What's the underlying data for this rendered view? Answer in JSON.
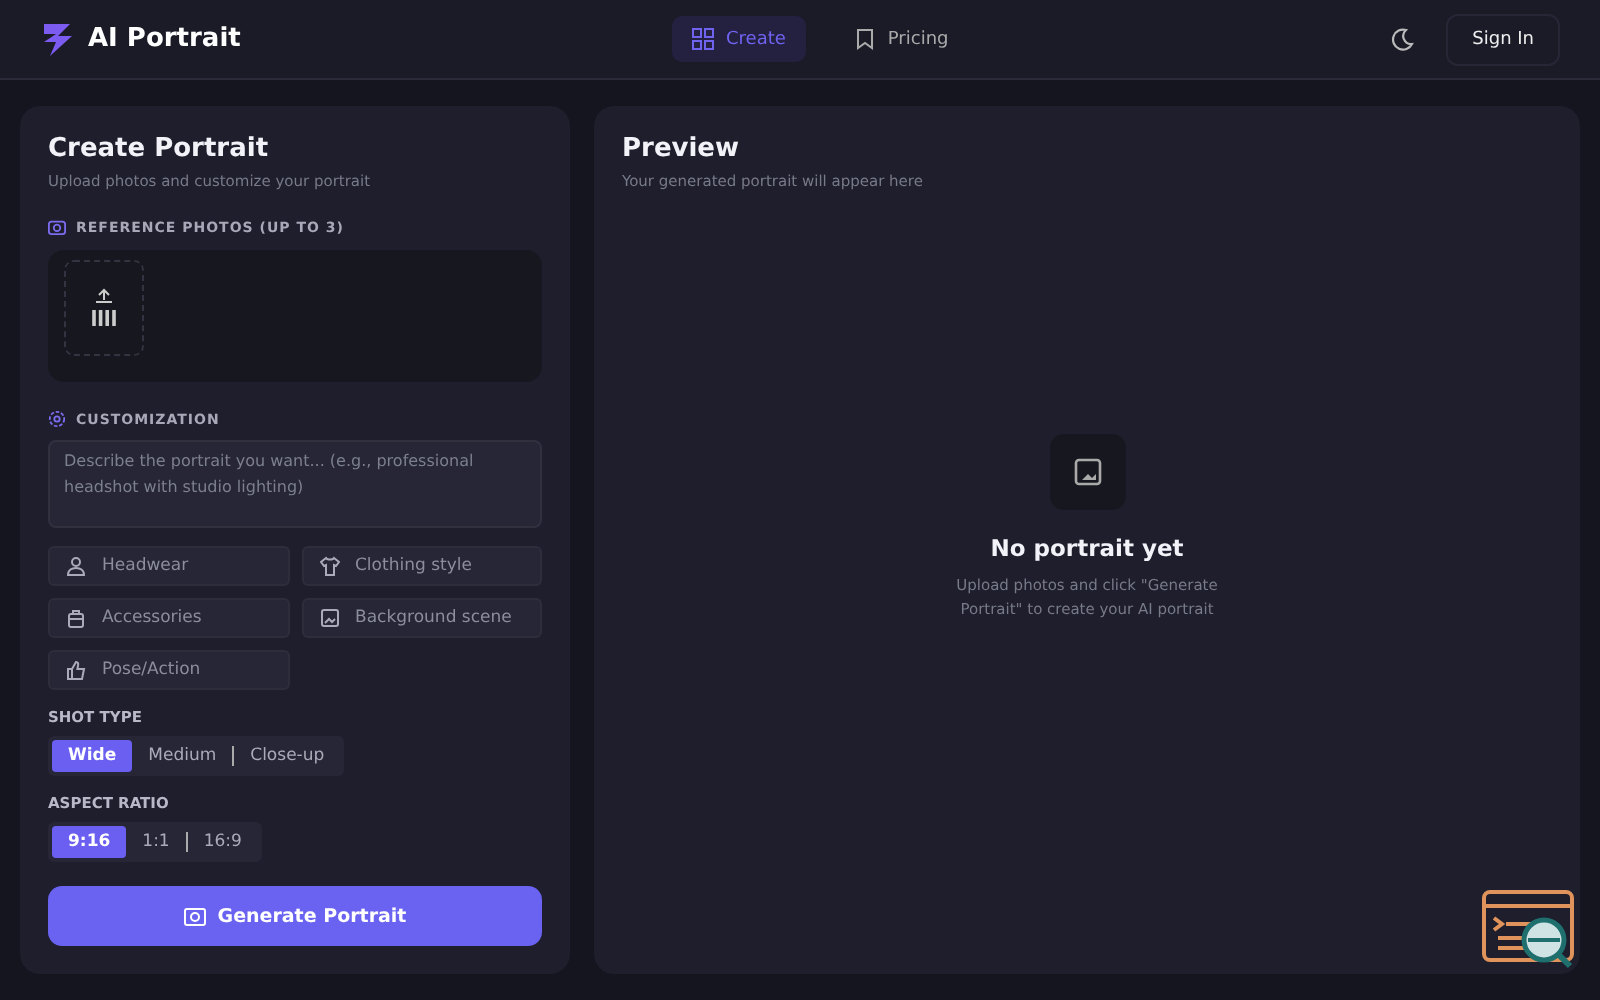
{
  "header": {
    "brand": "AI Portrait",
    "nav": [
      {
        "label": "Create",
        "selected": true
      },
      {
        "label": "Pricing",
        "selected": false
      }
    ],
    "sign_in": "Sign In"
  },
  "create_panel": {
    "title": "Create Portrait",
    "subtitle": "Upload photos and customize your portrait",
    "reference_label": "REFERENCE PHOTOS (UP TO 3)",
    "customization_label": "CUSTOMIZATION",
    "prompt": {
      "placeholder": "Describe the portrait you want... (e.g., professional headshot with studio lighting)"
    },
    "options": [
      "Headwear",
      "Clothing style",
      "Accessories",
      "Background scene",
      "Pose/Action"
    ],
    "shot_type": {
      "label": "SHOT TYPE",
      "choices": [
        {
          "label": "Wide",
          "selected": true
        },
        {
          "label": "Medium",
          "selected": false
        },
        {
          "label": "Close-up",
          "selected": false
        }
      ]
    },
    "aspect_ratio": {
      "label": "ASPECT RATIO",
      "choices": [
        {
          "label": "9:16",
          "selected": true
        },
        {
          "label": "1:1",
          "selected": false
        },
        {
          "label": "16:9",
          "selected": false
        }
      ]
    },
    "generate_button": "Generate Portrait"
  },
  "preview_panel": {
    "title": "Preview",
    "subtitle": "Your generated portrait will appear here",
    "empty_title": "No portrait yet",
    "empty_text": "Upload photos and click \"Generate Portrait\" to create your AI portrait"
  }
}
